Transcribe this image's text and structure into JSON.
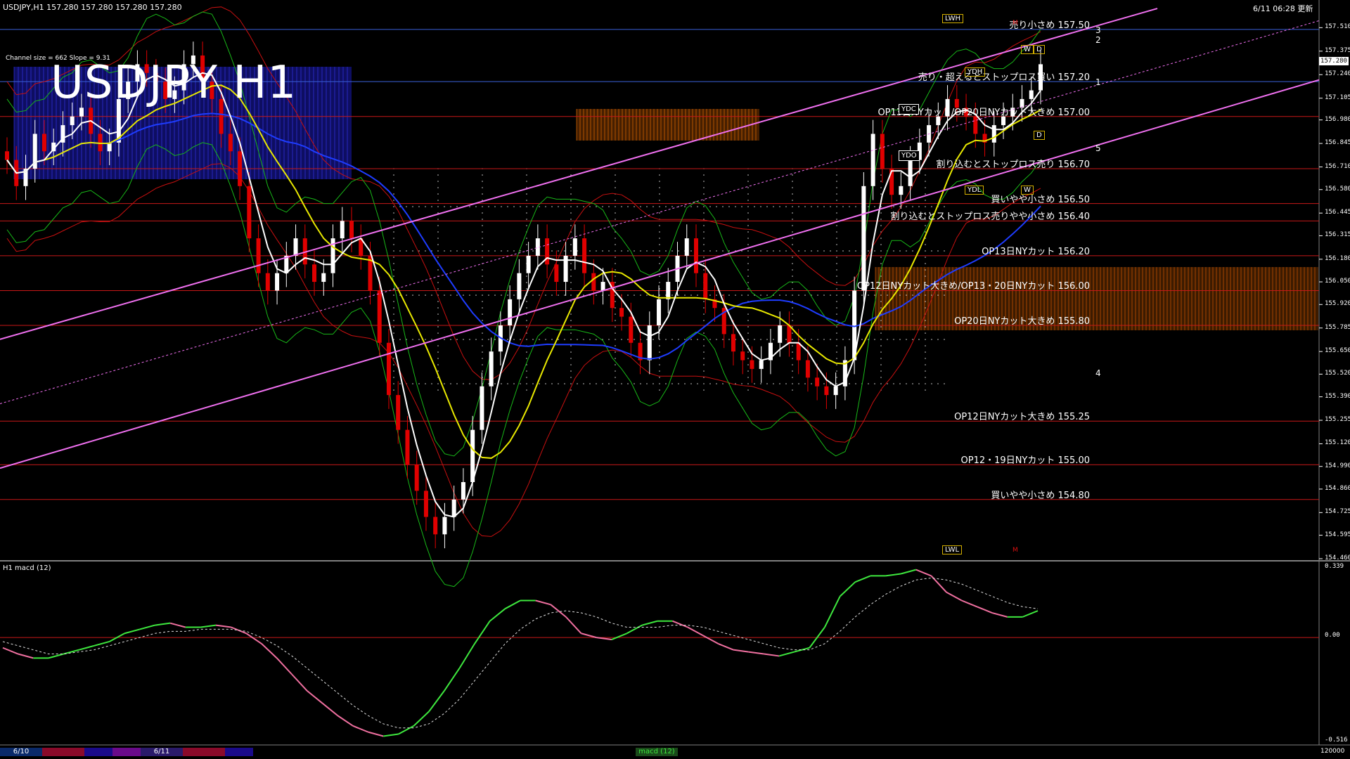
{
  "header": {
    "symbol_info": "USDJPY,H1  157.280 157.280 157.280 157.280",
    "timestamp": "6/11 06:28 更新",
    "big_title": "USDJPY H1",
    "channel_info": "Channel size = 662 Slope = 9.31",
    "macd_label": "H1  macd (12)"
  },
  "chart_data": {
    "type": "line",
    "title": "USDJPY H1",
    "price_axis": {
      "ticks": [
        "157.510",
        "157.375",
        "157.240",
        "157.105",
        "156.980",
        "156.845",
        "156.710",
        "156.580",
        "156.445",
        "156.315",
        "156.180",
        "156.050",
        "155.920",
        "155.785",
        "155.650",
        "155.520",
        "155.390",
        "155.255",
        "155.120",
        "154.990",
        "154.860",
        "154.725",
        "154.595",
        "154.460"
      ],
      "range": [
        154.46,
        157.58
      ],
      "current_price": "157.280"
    },
    "macd_axis": {
      "ticks": [
        "0.339",
        "0.00",
        "-0.516"
      ],
      "range": [
        -0.516,
        0.339
      ]
    },
    "levels": [
      {
        "price": 157.5,
        "text": "売り小さめ 157.50",
        "color": "#3a5fd8"
      },
      {
        "price": 157.2,
        "text": "売り・超えるとストップロス買い 157.20",
        "color": "#3a5fd8"
      },
      {
        "price": 157.0,
        "text": "OP13日NYカット/OP20日NYカット大きめ 157.00",
        "color": "#c81818"
      },
      {
        "price": 156.7,
        "text": "割り込むとストップロス売り 156.70",
        "color": "#c81818"
      },
      {
        "price": 156.5,
        "text": "買いやや小さめ 156.50",
        "color": "#c81818"
      },
      {
        "price": 156.4,
        "text": "割り込むとストップロス売りやや小さめ 156.40",
        "color": "#c81818"
      },
      {
        "price": 156.2,
        "text": "OP13日NYカット 156.20",
        "color": "#c81818"
      },
      {
        "price": 156.0,
        "text": "OP12日NYカット大きめ/OP13・20日NYカット 156.00",
        "color": "#c81818"
      },
      {
        "price": 155.8,
        "text": "OP20日NYカット大きめ 155.80",
        "color": "#c81818"
      },
      {
        "price": 155.25,
        "text": "OP12日NYカット大きめ 155.25",
        "color": "#c81818"
      },
      {
        "price": 155.0,
        "text": "OP12・19日NYカット 155.00",
        "color": "#c81818"
      },
      {
        "price": 154.8,
        "text": "買いやや小さめ 154.80",
        "color": "#c81818"
      }
    ],
    "candles_close": [
      156.75,
      156.6,
      156.7,
      156.9,
      156.8,
      156.85,
      156.95,
      157.0,
      157.05,
      156.9,
      156.8,
      156.85,
      157.1,
      157.2,
      157.3,
      157.25,
      157.2,
      157.1,
      157.15,
      157.3,
      157.35,
      157.2,
      157.1,
      156.9,
      156.8,
      156.6,
      156.3,
      156.1,
      156.0,
      156.1,
      156.2,
      156.3,
      156.15,
      156.05,
      156.1,
      156.3,
      156.4,
      156.3,
      156.2,
      156.0,
      155.7,
      155.4,
      155.2,
      155.0,
      154.85,
      154.7,
      154.6,
      154.7,
      154.8,
      154.9,
      155.2,
      155.45,
      155.65,
      155.8,
      155.95,
      156.1,
      156.2,
      156.3,
      156.15,
      156.05,
      156.2,
      156.3,
      156.1,
      156.0,
      156.05,
      155.9,
      155.85,
      155.7,
      155.6,
      155.8,
      155.95,
      156.05,
      156.2,
      156.3,
      156.1,
      155.95,
      155.9,
      155.75,
      155.65,
      155.6,
      155.55,
      155.6,
      155.7,
      155.8,
      155.7,
      155.6,
      155.5,
      155.45,
      155.4,
      155.45,
      155.6,
      156.0,
      156.6,
      156.9,
      156.7,
      156.55,
      156.6,
      156.75,
      156.85,
      156.95,
      157.0,
      157.1,
      157.05,
      157.0,
      156.9,
      156.85,
      156.95,
      157.0,
      157.05,
      157.1,
      157.15,
      157.3
    ],
    "macd_main": [
      -0.05,
      -0.08,
      -0.1,
      -0.1,
      -0.08,
      -0.06,
      -0.04,
      -0.02,
      0.02,
      0.04,
      0.06,
      0.07,
      0.05,
      0.05,
      0.06,
      0.05,
      0.02,
      -0.03,
      -0.1,
      -0.18,
      -0.26,
      -0.32,
      -0.38,
      -0.43,
      -0.46,
      -0.48,
      -0.47,
      -0.43,
      -0.36,
      -0.26,
      -0.15,
      -0.03,
      0.08,
      0.14,
      0.18,
      0.18,
      0.16,
      0.1,
      0.02,
      0.0,
      -0.01,
      0.02,
      0.06,
      0.08,
      0.08,
      0.05,
      0.01,
      -0.03,
      -0.06,
      -0.07,
      -0.08,
      -0.09,
      -0.07,
      -0.05,
      0.05,
      0.2,
      0.27,
      0.3,
      0.3,
      0.31,
      0.33,
      0.3,
      0.22,
      0.18,
      0.15,
      0.12,
      0.1,
      0.1,
      0.13
    ],
    "macd_signal": [
      -0.02,
      -0.04,
      -0.06,
      -0.08,
      -0.08,
      -0.07,
      -0.06,
      -0.04,
      -0.02,
      0.0,
      0.02,
      0.03,
      0.03,
      0.04,
      0.04,
      0.04,
      0.03,
      0.0,
      -0.04,
      -0.09,
      -0.15,
      -0.21,
      -0.27,
      -0.33,
      -0.38,
      -0.42,
      -0.44,
      -0.44,
      -0.42,
      -0.37,
      -0.3,
      -0.21,
      -0.12,
      -0.03,
      0.04,
      0.09,
      0.12,
      0.13,
      0.12,
      0.1,
      0.07,
      0.05,
      0.05,
      0.05,
      0.06,
      0.06,
      0.05,
      0.03,
      0.01,
      -0.01,
      -0.03,
      -0.05,
      -0.06,
      -0.06,
      -0.03,
      0.03,
      0.1,
      0.16,
      0.21,
      0.25,
      0.28,
      0.29,
      0.28,
      0.26,
      0.23,
      0.2,
      0.17,
      0.15,
      0.14
    ],
    "wave_labels": [
      "1",
      "2",
      "3",
      "4",
      "5"
    ],
    "date_labels": [
      "6/10",
      "6/11"
    ],
    "grid": false
  },
  "boxes": {
    "lwh": "LWH",
    "ydh": "YDH",
    "ydc": "YDC",
    "ydo": "YDO",
    "ydl": "YDL",
    "lwl": "LWL",
    "w": "W",
    "d": "D",
    "m": "M"
  },
  "bottom": {
    "macd_toggle": "macd (12)",
    "right_value": "120000"
  },
  "colors": {
    "bg": "#000000",
    "bull": "#ffffff",
    "bear": "#e00000",
    "ma_fast": "#ffffff",
    "ma_mid": "#e8e800",
    "ma_slow": "#1e3cff",
    "channel": "#f070f0",
    "macd_main": "#3ee83e",
    "macd_neg": "#f070a0",
    "bollinger": "#c81010",
    "envelope": "#18b818"
  }
}
